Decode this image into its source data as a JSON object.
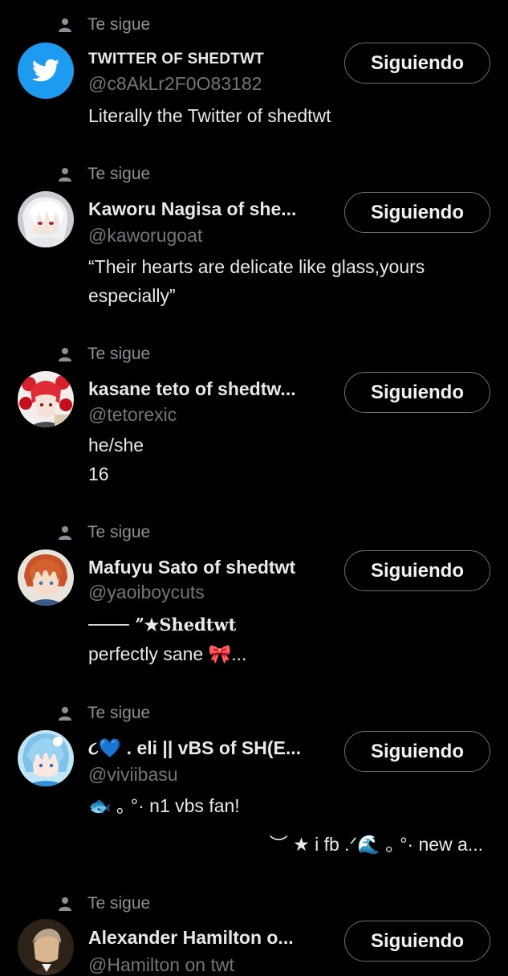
{
  "follows_label": "Te sigue",
  "button_label": "Siguiendo",
  "colors": {
    "background": "#000000",
    "text_primary": "#e7e9ea",
    "text_secondary": "#71767b",
    "button_border": "#6b7075",
    "twitter_blue": "#1d9bf0"
  },
  "users": [
    {
      "name": "TWITTER OF SHEDTWT",
      "handle": "@c8AkLr2F0O83182",
      "bio_lines": [
        "Literally the Twitter of shedtwt"
      ],
      "avatar": "twitter-bird-avatar"
    },
    {
      "name": "Kaworu Nagisa of she...",
      "handle": "@kaworugoat",
      "bio_lines": [
        "“Their hearts are delicate like glass,yours",
        "especially”"
      ],
      "avatar": "anime-white-hair-avatar"
    },
    {
      "name": "kasane teto of shedtw...",
      "handle": "@tetorexic",
      "bio_lines": [
        "he/she",
        "16"
      ],
      "avatar": "anime-red-hair-avatar"
    },
    {
      "name": "Mafuyu Sato of shedtwt",
      "handle": "@yaoiboycuts",
      "bio_lines": [
        "──── ˮ★Shedtwt",
        "perfectly sane   🎀..."
      ],
      "avatar": "anime-orange-hair-avatar"
    },
    {
      "name": "૮💙 . eli || vBS of SH(E...",
      "handle": "@viviibasu",
      "bio_lines": [
        "🐟 ｡ °·    n1 vbs fan!",
        "︶   ★   i fb .ᐟ🌊 ｡ °·    new a..."
      ],
      "avatar": "anime-blue-hair-avatar"
    },
    {
      "name": "Alexander Hamilton o...",
      "handle": "@Hamilton on twt",
      "bio_lines": [],
      "avatar": "hamilton-portrait-avatar"
    }
  ]
}
